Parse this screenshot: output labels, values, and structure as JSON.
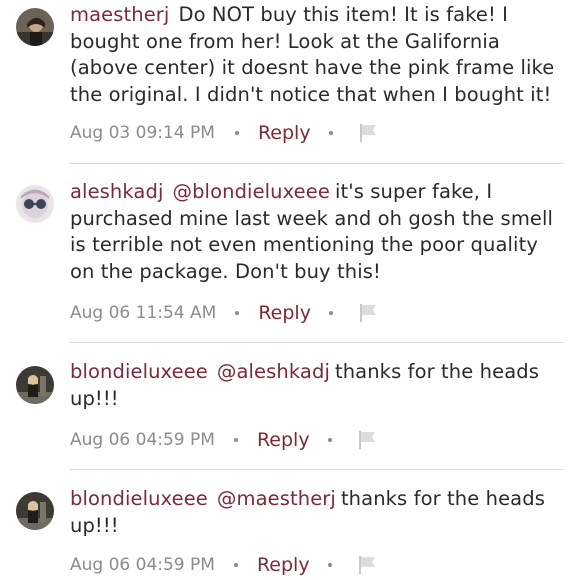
{
  "comments": [
    {
      "username": "maestherj",
      "mention": "",
      "text": "Do NOT buy this item! It is fake! I bought one from her! Look at the Galifornia (above center) it doesnt have the pink frame like the original. I didn't notice that when I bought it!",
      "timestamp": "Aug 03 09:14 PM",
      "reply_label": "Reply",
      "avatar_icon": "user-avatar-icon"
    },
    {
      "username": "aleshkadj",
      "mention": "@blondieluxeee",
      "text": "it's super fake, I purchased mine last week and oh gosh the smell is terrible not even mentioning the poor quality on the package. Don't buy this!",
      "timestamp": "Aug 06 11:54 AM",
      "reply_label": "Reply",
      "avatar_icon": "user-avatar-icon"
    },
    {
      "username": "blondieluxeee",
      "mention": "@aleshkadj",
      "text": "thanks for the heads up!!!",
      "timestamp": "Aug 06 04:59 PM",
      "reply_label": "Reply",
      "avatar_icon": "user-avatar-icon"
    },
    {
      "username": "blondieluxeee",
      "mention": "@maestherj",
      "text": "thanks for the heads up!!!",
      "timestamp": "Aug 06 04:59 PM",
      "reply_label": "Reply",
      "avatar_icon": "user-avatar-icon"
    }
  ],
  "colors": {
    "username": "#7a2a3a",
    "text": "#2a2a2a",
    "meta": "#8c8c8c",
    "divider": "#dcdcdc"
  }
}
